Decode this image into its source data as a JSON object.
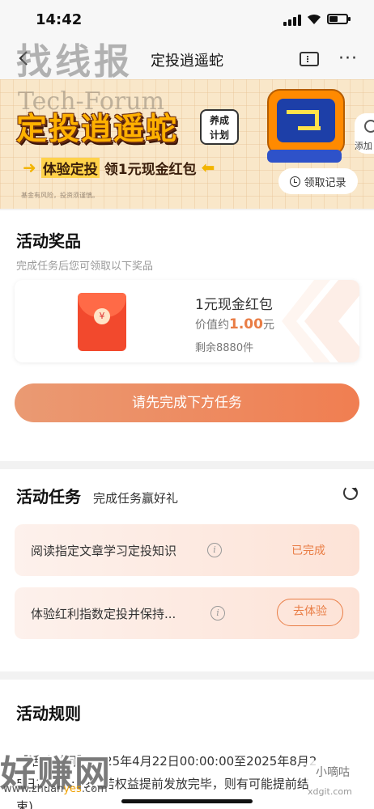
{
  "status_bar": {
    "time": "14:42"
  },
  "nav": {
    "title": "定投逍遥蛇",
    "more": "···"
  },
  "watermarks": {
    "top": "找线报",
    "tech": "Tech-Forum",
    "bottom": "好赚网",
    "url_prefix": "www.zhuan",
    "url_accent": "yes",
    "url_suffix": ".com",
    "small": "小嘀咕",
    "small_url": "xdgit.com"
  },
  "banner": {
    "title": "定投逍遥蛇",
    "badge_line1": "养成",
    "badge_line2": "计划",
    "sub_part1": "体验定投",
    "sub_part2": "领1元现金红包",
    "disclaimer": "基金有风险，投资须谨慎。",
    "side_label": "添加",
    "record_label": "领取记录"
  },
  "prizes": {
    "title": "活动奖品",
    "subtitle": "完成任务后您可领取以下奖品",
    "item": {
      "name": "1元现金红包",
      "value_prefix": "价值约",
      "value_amount": "1.00",
      "value_unit": "元",
      "remaining": "剩余8880件",
      "coin": "¥"
    },
    "cta": "请先完成下方任务"
  },
  "tasks": {
    "title": "活动任务",
    "subtitle": "完成任务赢好礼",
    "items": [
      {
        "label": "阅读指定文章学习定投知识",
        "status": "已完成"
      },
      {
        "label": "体验红利指数定投并保持...",
        "action": "去体验"
      }
    ]
  },
  "rules": {
    "title": "活动规则",
    "line1": "【活动时间】2025年4月22日00:00:00至2025年8月2",
    "line2": "5日23:59:59，若权益提前发放完毕，则有可能提前结",
    "line3": "束)"
  }
}
